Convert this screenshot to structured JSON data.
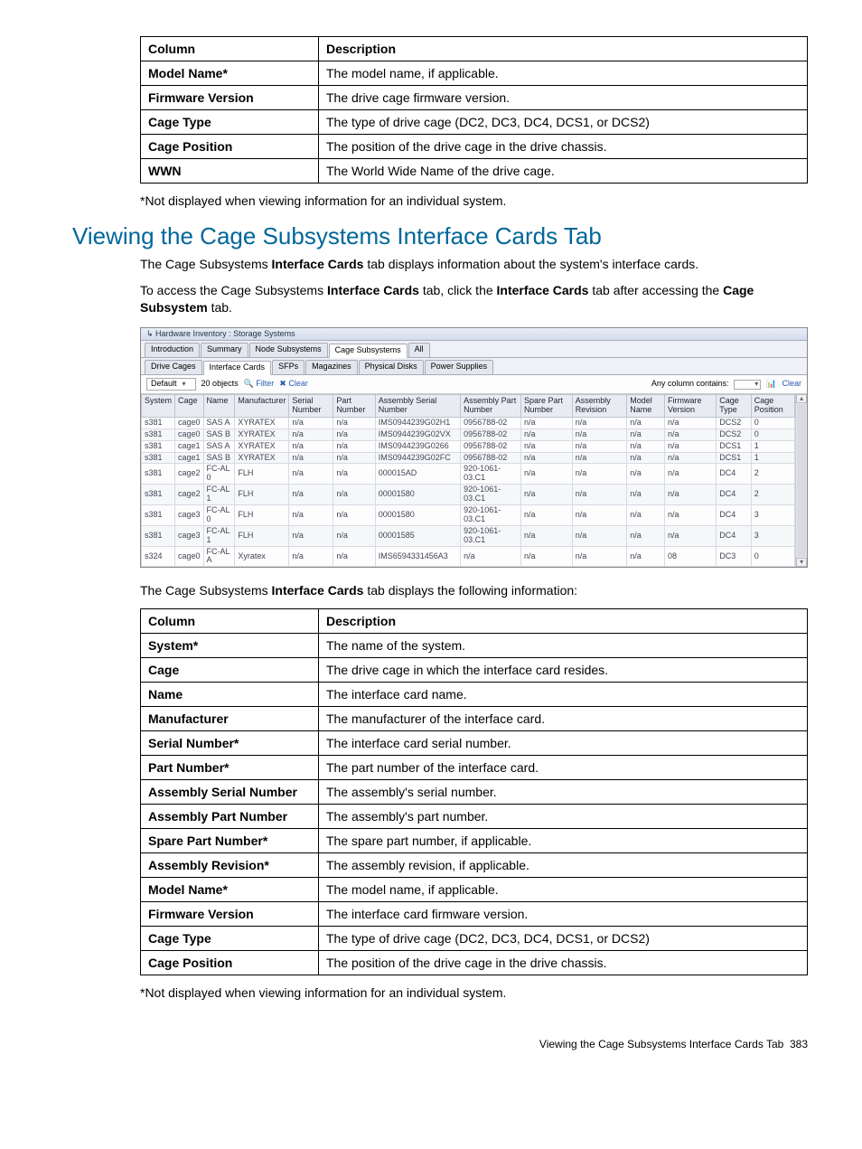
{
  "table1": {
    "head": [
      "Column",
      "Description"
    ],
    "rows": [
      [
        "Model Name*",
        "The model name, if applicable."
      ],
      [
        "Firmware Version",
        "The drive cage firmware version."
      ],
      [
        "Cage Type",
        "The type of drive cage (DC2, DC3, DC4, DCS1, or DCS2)"
      ],
      [
        "Cage Position",
        "The position of the drive cage in the drive chassis."
      ],
      [
        "WWN",
        "The World Wide Name of the drive cage."
      ]
    ]
  },
  "note1": "*Not displayed when viewing information for an individual system.",
  "heading": "Viewing the Cage Subsystems Interface Cards Tab",
  "intro1_pre": "The Cage Subsystems ",
  "intro1_bold": "Interface Cards",
  "intro1_post": " tab displays information about the system's interface cards.",
  "intro2_pre": "To access the Cage Subsystems ",
  "intro2_b1": "Interface Cards",
  "intro2_mid": " tab, click the ",
  "intro2_b2": "Interface Cards",
  "intro2_mid2": " tab after accessing the ",
  "intro2_b3": "Cage Subsystem",
  "intro2_post": " tab.",
  "shot": {
    "crumb": "Hardware Inventory : Storage Systems",
    "tabs1": [
      "Introduction",
      "Summary",
      "Node Subsystems",
      "Cage Subsystems",
      "All"
    ],
    "tabs1_active": 3,
    "tabs2": [
      "Drive Cages",
      "Interface Cards",
      "SFPs",
      "Magazines",
      "Physical Disks",
      "Power Supplies"
    ],
    "tabs2_active": 1,
    "toolbar": {
      "default": "Default",
      "objects": "20 objects",
      "filter": "Filter",
      "clear": "Clear",
      "anycol": "Any column contains:",
      "clear2": "Clear"
    },
    "grid_head": [
      "System",
      "Cage",
      "Name",
      "Manufacturer",
      "Serial Number",
      "Part Number",
      "Assembly Serial Number",
      "Assembly Part Number",
      "Spare Part Number",
      "Assembly Revision",
      "Model Name",
      "Firmware Version",
      "Cage Type",
      "Cage Position"
    ],
    "grid_rows": [
      [
        "s381",
        "cage0",
        "SAS A",
        "XYRATEX",
        "n/a",
        "n/a",
        "IMS0944239G02H1",
        "0956788-02",
        "n/a",
        "n/a",
        "n/a",
        "n/a",
        "DCS2",
        "0"
      ],
      [
        "s381",
        "cage0",
        "SAS B",
        "XYRATEX",
        "n/a",
        "n/a",
        "IMS0944239G02VX",
        "0956788-02",
        "n/a",
        "n/a",
        "n/a",
        "n/a",
        "DCS2",
        "0"
      ],
      [
        "s381",
        "cage1",
        "SAS A",
        "XYRATEX",
        "n/a",
        "n/a",
        "IMS0944239G0266",
        "0956788-02",
        "n/a",
        "n/a",
        "n/a",
        "n/a",
        "DCS1",
        "1"
      ],
      [
        "s381",
        "cage1",
        "SAS B",
        "XYRATEX",
        "n/a",
        "n/a",
        "IMS0944239G02FC",
        "0956788-02",
        "n/a",
        "n/a",
        "n/a",
        "n/a",
        "DCS1",
        "1"
      ],
      [
        "s381",
        "cage2",
        "FC-AL 0",
        "FLH",
        "n/a",
        "n/a",
        "000015AD",
        "920-1061-03.C1",
        "n/a",
        "n/a",
        "n/a",
        "n/a",
        "DC4",
        "2"
      ],
      [
        "s381",
        "cage2",
        "FC-AL 1",
        "FLH",
        "n/a",
        "n/a",
        "00001580",
        "920-1061-03.C1",
        "n/a",
        "n/a",
        "n/a",
        "n/a",
        "DC4",
        "2"
      ],
      [
        "s381",
        "cage3",
        "FC-AL 0",
        "FLH",
        "n/a",
        "n/a",
        "00001580",
        "920-1061-03.C1",
        "n/a",
        "n/a",
        "n/a",
        "n/a",
        "DC4",
        "3"
      ],
      [
        "s381",
        "cage3",
        "FC-AL 1",
        "FLH",
        "n/a",
        "n/a",
        "00001585",
        "920-1061-03.C1",
        "n/a",
        "n/a",
        "n/a",
        "n/a",
        "DC4",
        "3"
      ],
      [
        "s324",
        "cage0",
        "FC-AL A",
        "Xyratex",
        "n/a",
        "n/a",
        "IMS6594331456A3",
        "n/a",
        "n/a",
        "n/a",
        "n/a",
        "08",
        "DC3",
        "0"
      ]
    ]
  },
  "intro3_pre": "The Cage Subsystems ",
  "intro3_bold": "Interface Cards",
  "intro3_post": " tab displays the following information:",
  "table2": {
    "head": [
      "Column",
      "Description"
    ],
    "rows": [
      [
        "System*",
        "The name of the system."
      ],
      [
        "Cage",
        "The drive cage in which the interface card resides."
      ],
      [
        "Name",
        "The interface card name."
      ],
      [
        "Manufacturer",
        "The manufacturer of the interface card."
      ],
      [
        "Serial Number*",
        "The interface card serial number."
      ],
      [
        "Part Number*",
        "The part number of the interface card."
      ],
      [
        "Assembly Serial Number",
        "The assembly's serial number."
      ],
      [
        "Assembly Part Number",
        "The assembly's part number."
      ],
      [
        "Spare Part Number*",
        "The spare part number, if applicable."
      ],
      [
        "Assembly Revision*",
        "The assembly revision, if applicable."
      ],
      [
        "Model Name*",
        "The model name, if applicable."
      ],
      [
        "Firmware Version",
        "The interface card firmware version."
      ],
      [
        "Cage Type",
        "The type of drive cage (DC2, DC3, DC4, DCS1, or DCS2)"
      ],
      [
        "Cage Position",
        "The position of the drive cage in the drive chassis."
      ]
    ]
  },
  "note2": "*Not displayed when viewing information for an individual system.",
  "footer_text": "Viewing the Cage Subsystems Interface Cards Tab",
  "footer_page": "383"
}
